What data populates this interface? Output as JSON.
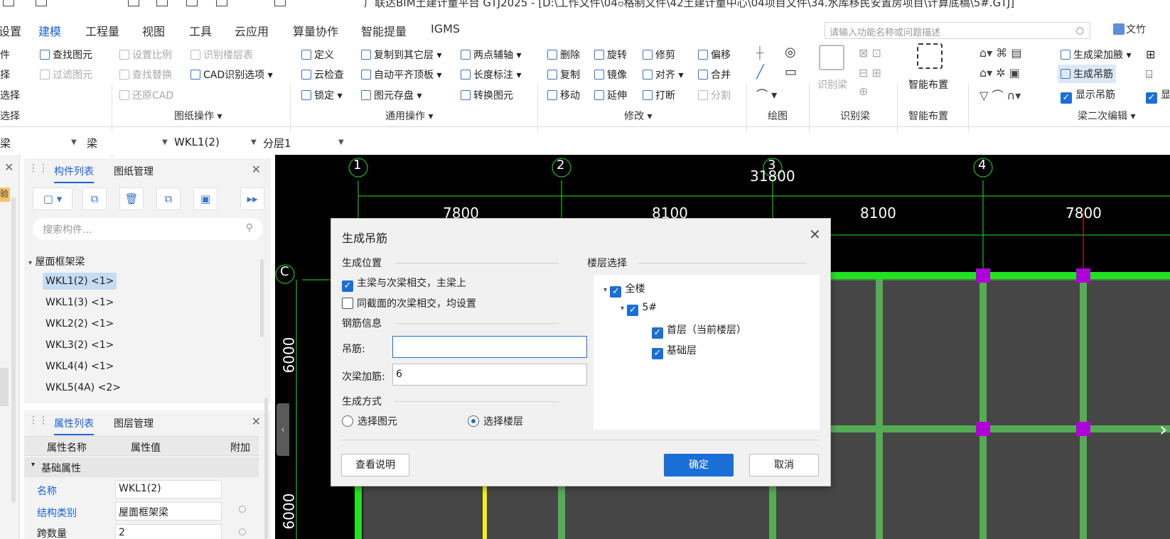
{
  "window": {
    "title": "广联达BIM土建计量平台 GTJ2025 - [D:\\工作文件\\04ဗ格制文件\\42土建计量中心\\04项目文件\\34.水库移民安置房项目\\计算底稿\\5#.GTJ]"
  },
  "menu": {
    "items": [
      "设置",
      "建模",
      "工程量",
      "视图",
      "工具",
      "云应用",
      "算量协作",
      "智能提量",
      "IGMS"
    ],
    "active": "建模"
  },
  "search": {
    "placeholder": "请输入功能名称或问题描述"
  },
  "user": {
    "label": "文竹"
  },
  "ribbon": {
    "select_group": {
      "items": [
        "件",
        "择",
        "选择"
      ],
      "label": "选择"
    },
    "drawing_ops": {
      "items": [
        "查找图元",
        "设置比例",
        "识别楼层表",
        "过滤图元",
        "查找替换",
        "CAD识别选项",
        "还原CAD"
      ],
      "label": "图纸操作"
    },
    "common_ops": {
      "items": [
        "定义",
        "复制到其它层",
        "两点辅轴",
        "云检查",
        "自动平齐顶板",
        "长度标注",
        "锁定",
        "图元存盘",
        "转换图元"
      ],
      "label": "通用操作"
    },
    "modify": {
      "items": [
        "删除",
        "旋转",
        "修剪",
        "偏移",
        "复制",
        "镜像",
        "对齐",
        "合并",
        "移动",
        "延伸",
        "打断",
        "分割"
      ],
      "label": "修改"
    },
    "draw": {
      "label": "绘图"
    },
    "recognize": {
      "big": "识别梁",
      "label": "识别梁"
    },
    "smart": {
      "big": "智能布置",
      "label": "智能布置"
    },
    "secondary": {
      "items": [
        "生成梁加腋",
        "生成吊筋",
        "显示吊筋",
        "显"
      ],
      "label": "梁二次编辑"
    }
  },
  "toolbar": {
    "sel1": "梁",
    "sel2": "梁",
    "sel3": "WKL1(2)",
    "sel4": "分层1"
  },
  "left_edge": {
    "label": "验"
  },
  "component_panel": {
    "tabs": [
      "构件列表",
      "图纸管理"
    ],
    "search_placeholder": "搜索构件...",
    "group": "屋面框架梁",
    "items": [
      "WKL1(2) <1>",
      "WKL1(3) <1>",
      "WKL2(2) <1>",
      "WKL3(2) <1>",
      "WKL4(4) <1>",
      "WKL5(4A) <2>"
    ]
  },
  "property_panel": {
    "tabs": [
      "属性列表",
      "图层管理"
    ],
    "columns": [
      "属性名称",
      "属性值",
      "附加"
    ],
    "group": "基础属性",
    "rows": [
      {
        "name": "名称",
        "value": "WKL1(2)"
      },
      {
        "name": "结构类别",
        "value": "屋面框架梁"
      },
      {
        "name": "跨数量",
        "value": "2"
      }
    ]
  },
  "cad": {
    "axes": [
      "1",
      "2",
      "3",
      "4"
    ],
    "row_axis": "C",
    "total_dim": "31800",
    "dims": [
      "7800",
      "8100",
      "8100",
      "7800"
    ],
    "vdims": [
      "6000",
      "6000"
    ]
  },
  "dialog": {
    "title": "生成吊筋",
    "pos_section": "生成位置",
    "pos_opt1": "主梁与次梁相交，主梁上",
    "pos_opt2": "同截面的次梁相交，均设置",
    "rebar_section": "钢筋信息",
    "hanger_label": "吊筋:",
    "hanger_value": "",
    "extra_label": "次梁加筋:",
    "extra_value": "6",
    "mode_section": "生成方式",
    "mode_opt1": "选择图元",
    "mode_opt2": "选择楼层",
    "floor_section": "楼层选择",
    "floor_tree": [
      "全楼",
      "5#",
      "首层（当前楼层）",
      "基础层"
    ],
    "help_button": "查看说明",
    "ok_button": "确定",
    "cancel_button": "取消"
  },
  "colors": {
    "accent": "#1a63d6",
    "beam": "#22e322",
    "node": "#b000d8",
    "cad_bg": "#000000"
  }
}
